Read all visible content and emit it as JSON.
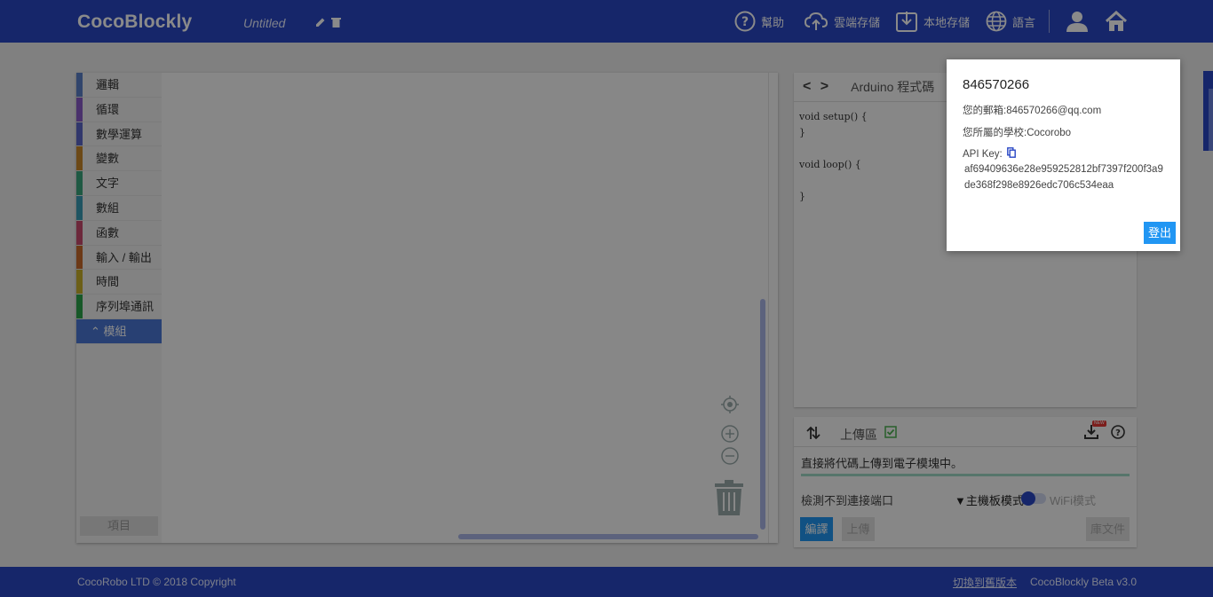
{
  "header": {
    "logo": "CocoBlockly",
    "doc_title": "Untitled",
    "nav": {
      "help": "幫助",
      "cloud_save": "雲端存儲",
      "local_save": "本地存儲",
      "language": "語言"
    }
  },
  "toolbox": {
    "items": [
      {
        "label": "邏輯",
        "color": "#5b80c7"
      },
      {
        "label": "循環",
        "color": "#8a5bc7"
      },
      {
        "label": "數學運算",
        "color": "#5b67c7"
      },
      {
        "label": "變數",
        "color": "#c7882b"
      },
      {
        "label": "文字",
        "color": "#3aa57c"
      },
      {
        "label": "數組",
        "color": "#3a9bb5"
      },
      {
        "label": "函數",
        "color": "#c74a6d"
      },
      {
        "label": "輸入 / 輸出",
        "color": "#c76a2b"
      },
      {
        "label": "時間",
        "color": "#c7b02b"
      },
      {
        "label": "序列埠通訊",
        "color": "#2ba34a"
      }
    ],
    "active_item": "⌃ 模組",
    "project_button": "項目"
  },
  "code_panel": {
    "brackets": "< >",
    "title": "Arduino 程式碼",
    "code": "void setup() {\n}\n\nvoid loop() {\n\n}"
  },
  "upload_panel": {
    "title": "上傳區",
    "message": "直接將代碼上傳到電子模塊中。",
    "status": "檢測不到連接端口",
    "mode_main": "▼主機板模式",
    "mode_wifi": "WiFi模式",
    "compile_button": "編譯",
    "upload_button": "上傳",
    "library_button": "庫文件",
    "badge": "NEW"
  },
  "footer": {
    "copyright": "CocoRobo LTD © 2018 Copyright",
    "switch_link": "切換到舊版本",
    "version": "CocoBlockly Beta v3.0"
  },
  "popup": {
    "username": "846570266",
    "email_line": "您的郵箱:846570266@qq.com",
    "school_line": "您所屬的學校:Cocorobo",
    "api_key_label": "API Key:",
    "api_key": "af69409636e28e959252812bf7397f200f3a9de368f298e8926edc706c534eaa",
    "logout_button": "登出"
  },
  "colors": {
    "brand": "#2a47c4",
    "button_blue": "#2196f3"
  }
}
